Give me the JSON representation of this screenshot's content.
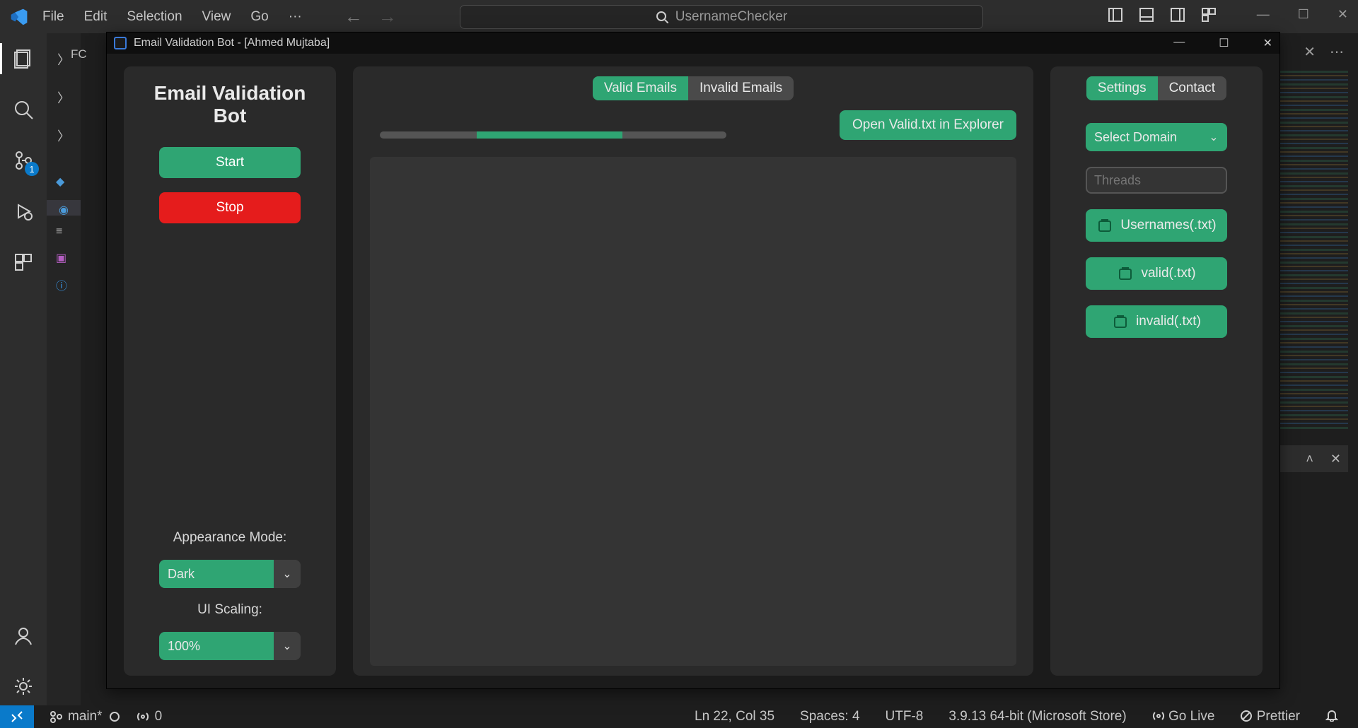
{
  "vscode": {
    "menu": [
      "File",
      "Edit",
      "Selection",
      "View",
      "Go",
      "···"
    ],
    "search_hint": "UsernameChecker",
    "folder_label": "FC",
    "scm_badge": "1",
    "status": {
      "branch": "main*",
      "ports": "0",
      "cursor": "Ln 22, Col 35",
      "spaces": "Spaces: 4",
      "encoding": "UTF-8",
      "python": "3.9.13 64-bit (Microsoft Store)",
      "golive": "Go Live",
      "prettier": "Prettier"
    }
  },
  "app": {
    "window_title": "Email Validation Bot - [Ahmed Mujtaba]",
    "title": "Email Validation Bot",
    "buttons": {
      "start": "Start",
      "stop": "Stop",
      "open_valid": "Open Valid.txt in Explorer"
    },
    "appearance_label": "Appearance Mode:",
    "appearance_value": "Dark",
    "scaling_label": "UI Scaling:",
    "scaling_value": "100%",
    "tabs": {
      "valid": "Valid Emails",
      "invalid": "Invalid Emails"
    },
    "right_tabs": {
      "settings": "Settings",
      "contact": "Contact"
    },
    "domain_select": "Select Domain",
    "threads_placeholder": "Threads",
    "file_buttons": {
      "usernames": "Usernames(.txt)",
      "valid": "valid(.txt)",
      "invalid": "invalid(.txt)"
    }
  }
}
